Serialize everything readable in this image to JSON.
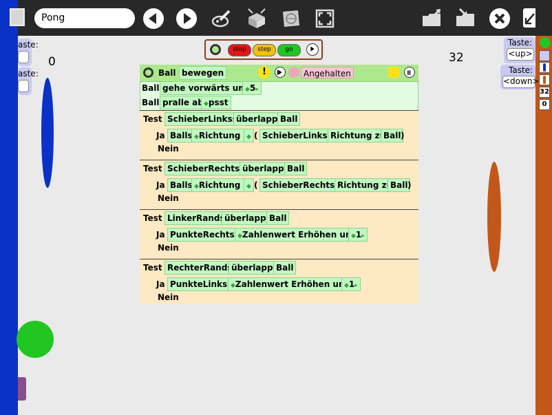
{
  "toolbar": {
    "project_name": "Pong"
  },
  "scoreboard": {
    "left_score": "0",
    "right_score": "32"
  },
  "playback": {
    "stop_label": "stop",
    "step_label": "step",
    "go_label": "go"
  },
  "keys_left": {
    "top_label": "aste:",
    "bottom_label": "aste:"
  },
  "keys_right": {
    "up_title": "Taste:",
    "up_value": "<up>",
    "down_title": "Taste:",
    "down_value": "<down>"
  },
  "mini_panel": {
    "number_a": "32",
    "number_b": "0"
  },
  "script": {
    "object": "Ball",
    "name": "bewegen",
    "status": "Angehalten",
    "line1": {
      "obj": "Ball",
      "cmd": "gehe vorwärts um",
      "value": "5"
    },
    "line2": {
      "obj": "Ball",
      "cmd": "pralle ab",
      "sound": "psst"
    },
    "tests": [
      {
        "test_label": "Test",
        "cond_a": "SchieberLinkss",
        "cond_op": "überlappt",
        "cond_b": "Ball",
        "yes_label": "Ja",
        "yes_obj": "Balls",
        "yes_attr": "Richtung",
        "yes_op": "←",
        "paren_open": "(",
        "yes_src": "SchieberLinkss",
        "yes_fn": "Richtung zu",
        "yes_target": "Ball",
        "paren_close": ")",
        "no_label": "Nein"
      },
      {
        "test_label": "Test",
        "cond_a": "SchieberRechtss",
        "cond_op": "überlappt",
        "cond_b": "Ball",
        "yes_label": "Ja",
        "yes_obj": "Balls",
        "yes_attr": "Richtung",
        "yes_op": "←",
        "paren_open": "(",
        "yes_src": "SchieberRechtss",
        "yes_fn": "Richtung zu",
        "yes_target": "Ball",
        "paren_close": ")",
        "no_label": "Nein"
      },
      {
        "test_label": "Test",
        "cond_a": "LinkerRands",
        "cond_op": "überlappt",
        "cond_b": "Ball",
        "yes_label": "Ja",
        "yes_obj": "PunkteRechtss",
        "yes_cmd": "Zahlenwert Erhöhen um",
        "yes_value": "1",
        "no_label": "Nein"
      },
      {
        "test_label": "Test",
        "cond_a": "RechterRands",
        "cond_op": "überlappt",
        "cond_b": "Ball",
        "yes_label": "Ja",
        "yes_obj": "PunkteLinkss",
        "yes_cmd": "Zahlenwert Erhöhen um",
        "yes_value": "1",
        "no_label": "Nein"
      }
    ]
  },
  "colors": {
    "toolbar": "#282828",
    "left_paddle": "#0a32c8",
    "right_paddle": "#c3571a",
    "ball": "#22c622",
    "tile": "#c2f7c2",
    "test_block": "#fde9c4",
    "script_header": "#aee88e"
  }
}
